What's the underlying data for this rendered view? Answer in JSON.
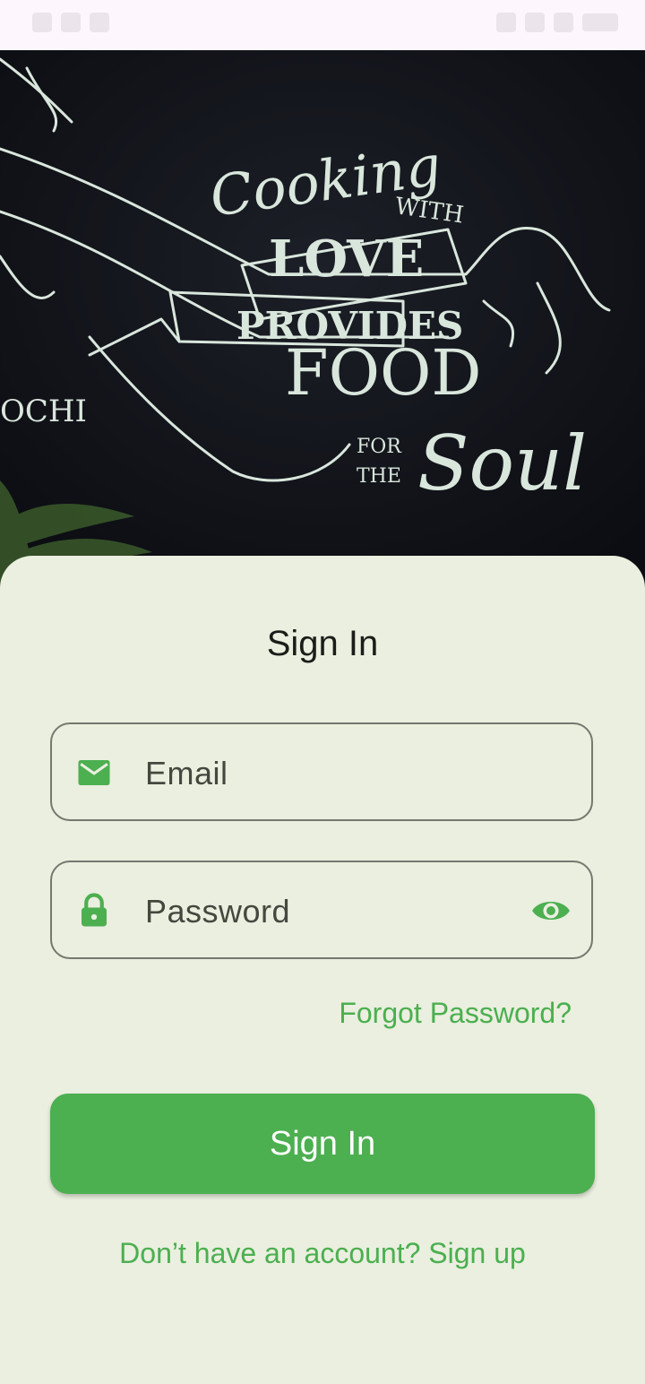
{
  "hero": {
    "lettering": [
      "Cooking",
      "WITH",
      "LOVE",
      "PROVIDES",
      "FOOD",
      "FOR",
      "THE",
      "Soul",
      "OCHI"
    ]
  },
  "card": {
    "title": "Sign In",
    "email": {
      "placeholder": "Email",
      "icon": "mail-icon"
    },
    "password": {
      "placeholder": "Password",
      "icon": "lock-icon",
      "toggle_icon": "eye-icon"
    },
    "forgot_label": "Forgot Password?",
    "signin_label": "Sign In",
    "signup_label": "Don’t have an account? Sign up"
  },
  "colors": {
    "accent": "#4caf50",
    "background": "#eaefdf",
    "hero_bg": "#101218",
    "chalk": "#d9e6dc"
  }
}
